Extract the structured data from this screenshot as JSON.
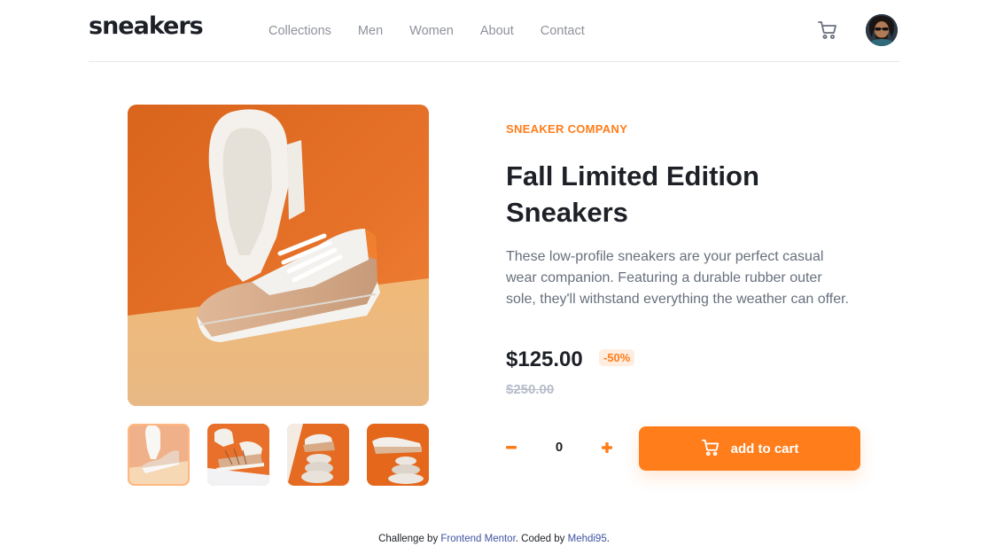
{
  "header": {
    "logo": "sneakers",
    "nav": [
      "Collections",
      "Men",
      "Women",
      "About",
      "Contact"
    ]
  },
  "product": {
    "company": "SNEAKER COMPANY",
    "title": "Fall Limited Edition Sneakers",
    "description": "These low-profile sneakers are your perfect casual wear companion. Featuring a durable rubber outer sole, they'll withstand everything the weather can offer.",
    "price": "$125.00",
    "discount": "-50%",
    "old_price": "$250.00",
    "quantity": "0",
    "add_to_cart_label": "add to cart"
  },
  "gallery": {
    "thumbnail_count": 4,
    "active_index": 0
  },
  "footer": {
    "prefix": "Challenge by ",
    "link1": "Frontend Mentor",
    "middle": ". Coded by ",
    "link2": "Mehdi95",
    "suffix": "."
  },
  "colors": {
    "accent": "#ff7d1a",
    "accent_pale": "#ffede0",
    "text_dark": "#1d2026",
    "text_gray": "#68707d",
    "nav_gray": "#8f929c",
    "link_blue": "#3e52a3"
  },
  "icons": {
    "cart": "cart-icon",
    "minus": "minus-icon",
    "plus": "plus-icon"
  }
}
